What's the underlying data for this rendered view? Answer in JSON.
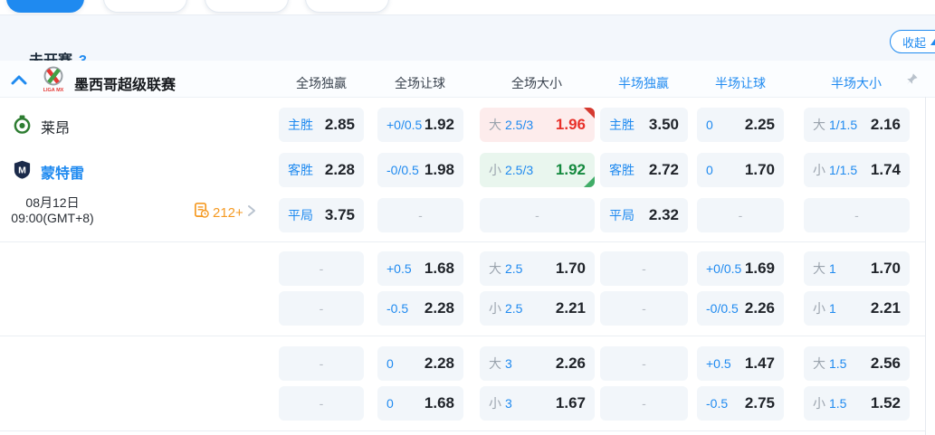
{
  "colors": {
    "accent": "#1f8af0",
    "odds_up": "#e8302a",
    "odds_down": "#14893e"
  },
  "status_bar": {
    "title": "未开赛",
    "count": "3",
    "collapse_label": "收起"
  },
  "league": {
    "name": "墨西哥超级联赛",
    "logo_text": "LIGA MX"
  },
  "columns": {
    "full_win": "全场独赢",
    "full_handicap": "全场让球",
    "full_ou": "全场大小",
    "half_win": "半场独赢",
    "half_handicap": "半场让球",
    "half_ou": "半场大小"
  },
  "match": {
    "home": "莱昂",
    "away": "蒙特雷",
    "date": "08月12日",
    "time": "09:00(GMT+8)",
    "more_count": "212+"
  },
  "icons": {
    "collapse_button": "caret-up",
    "league_expand": "chevron-up",
    "pin": "pin",
    "more_markets": "stats-clock",
    "more_arrow": "chevron-right"
  },
  "cells": {
    "r1c1": {
      "label": "主胜",
      "value": "2.85"
    },
    "r1c2": {
      "label": "+0/0.5",
      "value": "1.92"
    },
    "r1c3": {
      "side": "大",
      "line": "2.5/3",
      "value": "1.96",
      "trend": "up"
    },
    "r1c4": {
      "label": "主胜",
      "value": "3.50"
    },
    "r1c5": {
      "label": "0",
      "value": "2.25"
    },
    "r1c6": {
      "side": "大",
      "line": "1/1.5",
      "value": "2.16"
    },
    "r2c1": {
      "label": "客胜",
      "value": "2.28"
    },
    "r2c2": {
      "label": "-0/0.5",
      "value": "1.98"
    },
    "r2c3": {
      "side": "小",
      "line": "2.5/3",
      "value": "1.92",
      "trend": "down"
    },
    "r2c4": {
      "label": "客胜",
      "value": "2.72"
    },
    "r2c5": {
      "label": "0",
      "value": "1.70"
    },
    "r2c6": {
      "side": "小",
      "line": "1/1.5",
      "value": "1.74"
    },
    "r3c1": {
      "label": "平局",
      "value": "3.75"
    },
    "r3c2": {
      "dash": "-"
    },
    "r3c3": {
      "dash": "-"
    },
    "r3c4": {
      "label": "平局",
      "value": "2.32"
    },
    "r3c5": {
      "dash": "-"
    },
    "r3c6": {
      "dash": "-"
    },
    "r4c1": {
      "dash": "-"
    },
    "r4c2": {
      "label": "+0.5",
      "value": "1.68"
    },
    "r4c3": {
      "side": "大",
      "line": "2.5",
      "value": "1.70"
    },
    "r4c4": {
      "dash": "-"
    },
    "r4c5": {
      "label": "+0/0.5",
      "value": "1.69"
    },
    "r4c6": {
      "side": "大",
      "line": "1",
      "value": "1.70"
    },
    "r5c1": {
      "dash": "-"
    },
    "r5c2": {
      "label": "-0.5",
      "value": "2.28"
    },
    "r5c3": {
      "side": "小",
      "line": "2.5",
      "value": "2.21"
    },
    "r5c4": {
      "dash": "-"
    },
    "r5c5": {
      "label": "-0/0.5",
      "value": "2.26"
    },
    "r5c6": {
      "side": "小",
      "line": "1",
      "value": "2.21"
    },
    "r6c1": {
      "dash": "-"
    },
    "r6c2": {
      "label": "0",
      "value": "2.28"
    },
    "r6c3": {
      "side": "大",
      "line": "3",
      "value": "2.26"
    },
    "r6c4": {
      "dash": "-"
    },
    "r6c5": {
      "label": "+0.5",
      "value": "1.47"
    },
    "r6c6": {
      "side": "大",
      "line": "1.5",
      "value": "2.56"
    },
    "r7c1": {
      "dash": "-"
    },
    "r7c2": {
      "label": "0",
      "value": "1.68"
    },
    "r7c3": {
      "side": "小",
      "line": "3",
      "value": "1.67"
    },
    "r7c4": {
      "dash": "-"
    },
    "r7c5": {
      "label": "-0.5",
      "value": "2.75"
    },
    "r7c6": {
      "side": "小",
      "line": "1.5",
      "value": "1.52"
    }
  }
}
